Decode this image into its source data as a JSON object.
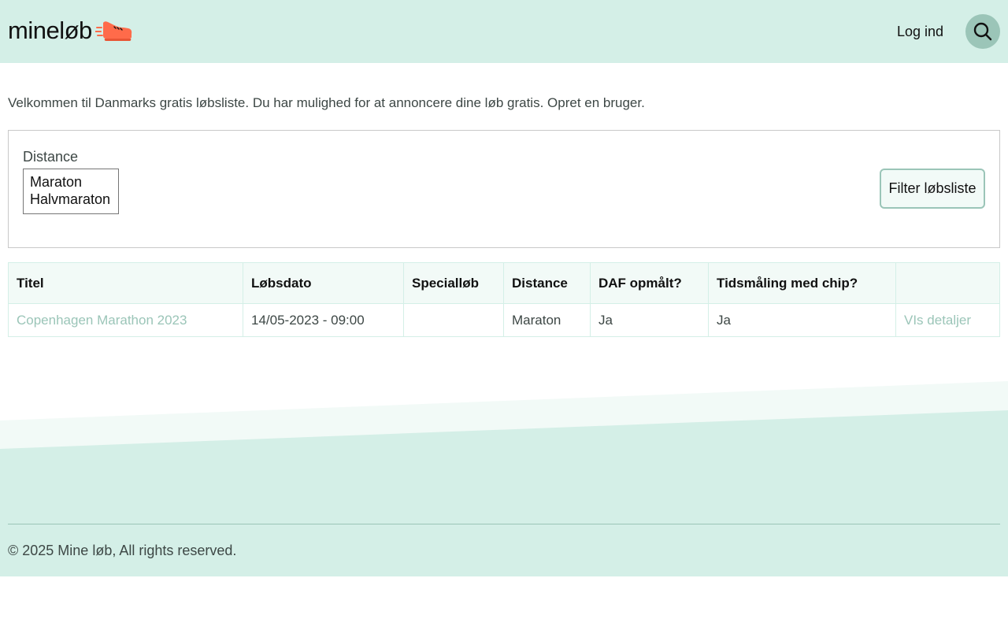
{
  "header": {
    "logo_text": "mineløb",
    "login_label": "Log ind"
  },
  "intro": {
    "text": "Velkommen til Danmarks gratis løbsliste. Du har mulighed for at annoncere dine løb gratis. Opret en bruger."
  },
  "filter": {
    "label": "Distance",
    "options": [
      "Maraton",
      "Halvmaraton"
    ],
    "button_label": "Filter løbsliste"
  },
  "table": {
    "headers": [
      "Titel",
      "Løbsdato",
      "Specialløb",
      "Distance",
      "DAF opmålt?",
      "Tidsmåling med chip?",
      ""
    ],
    "rows": [
      {
        "title": "Copenhagen Marathon 2023",
        "date": "14/05-2023 - 09:00",
        "special": "",
        "distance": "Maraton",
        "daf": "Ja",
        "chip": "Ja",
        "details": "VIs detaljer"
      }
    ]
  },
  "footer": {
    "copyright": "© 2025 Mine løb, All rights reserved."
  },
  "colors": {
    "header_bg": "#d4efe7",
    "accent": "#9bc5b8",
    "shoe": "#ff6b4a",
    "footer_light": "#f2faf7"
  },
  "icons": {
    "logo": "running-shoe-icon",
    "search": "search-icon"
  }
}
